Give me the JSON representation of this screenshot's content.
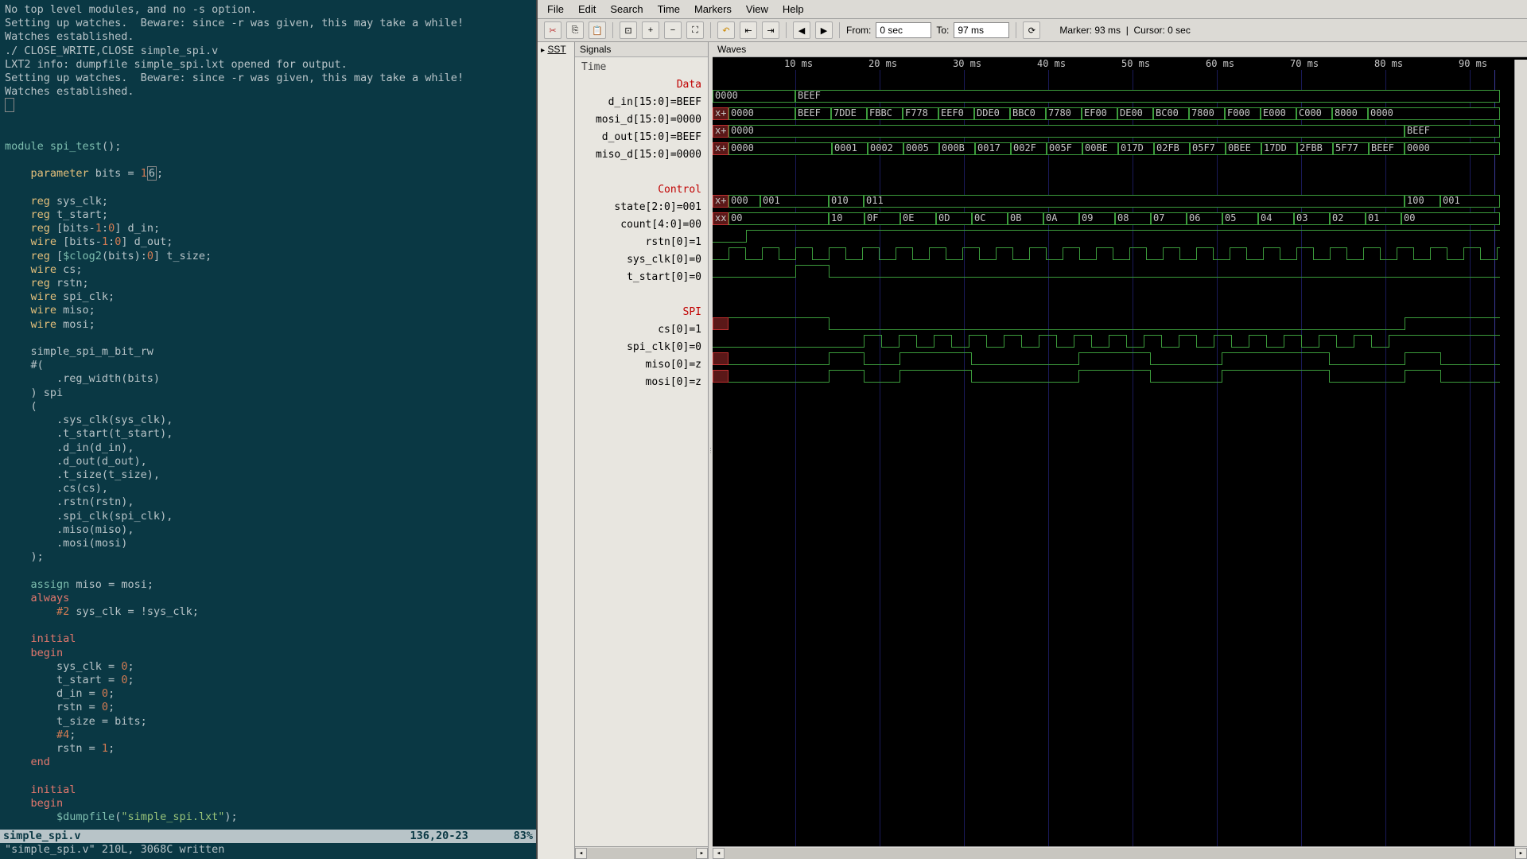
{
  "terminal": {
    "lines": [
      "No top level modules, and no -s option.",
      "Setting up watches.  Beware: since -r was given, this may take a while!",
      "Watches established.",
      "./ CLOSE_WRITE,CLOSE simple_spi.v",
      "LXT2 info: dumpfile simple_spi.lxt opened for output.",
      "Setting up watches.  Beware: since -r was given, this may take a while!",
      "Watches established."
    ]
  },
  "editor": {
    "status_file": "simple_spi.v",
    "status_pos": "136,20-23",
    "status_pct": "83%",
    "msg": "\"simple_spi.v\" 210L, 3068C written"
  },
  "gtkwave": {
    "menus": [
      "File",
      "Edit",
      "Search",
      "Time",
      "Markers",
      "View",
      "Help"
    ],
    "from_label": "From:",
    "from_value": "0 sec",
    "to_label": "To:",
    "to_value": "97 ms",
    "status_marker": "Marker: 93 ms",
    "status_cursor": "Cursor: 0 sec",
    "sst_label": "SST",
    "signals_label": "Signals",
    "waves_label": "Waves",
    "time_label": "Time",
    "timeticks": [
      "10 ms",
      "20 ms",
      "30 ms",
      "40 ms",
      "50 ms",
      "60 ms",
      "70 ms",
      "80 ms",
      "90 ms"
    ],
    "groups": {
      "data": "Data",
      "control": "Control",
      "spi": "SPI"
    },
    "signals": {
      "d_in": "d_in[15:0]=BEEF",
      "mosi_d": "mosi_d[15:0]=0000",
      "d_out": "d_out[15:0]=BEEF",
      "miso_d": "miso_d[15:0]=0000",
      "state": "state[2:0]=001",
      "count": "count[4:0]=00",
      "rstn": "rstn[0]=1",
      "sys_clk": "sys_clk[0]=0",
      "t_start": "t_start[0]=0",
      "cs": "cs[0]=1",
      "spi_clk": "spi_clk[0]=0",
      "miso": "miso[0]=z",
      "mosi": "mosi[0]=z"
    },
    "wave_values": {
      "d_in": [
        "0000",
        "BEEF"
      ],
      "mosi_d": [
        "x+",
        "0000",
        "BEEF",
        "7DDE",
        "FBBC",
        "F778",
        "EEF0",
        "DDE0",
        "BBC0",
        "7780",
        "EF00",
        "DE00",
        "BC00",
        "7800",
        "F000",
        "E000",
        "C000",
        "8000",
        "0000"
      ],
      "d_out": [
        "x+",
        "0000",
        "BEEF"
      ],
      "miso_d": [
        "x+",
        "0000",
        "0001",
        "0002",
        "0005",
        "000B",
        "0017",
        "002F",
        "005F",
        "00BE",
        "017D",
        "02FB",
        "05F7",
        "0BEE",
        "17DD",
        "2FBB",
        "5F77",
        "BEEF",
        "0000"
      ],
      "state": [
        "x+",
        "000",
        "001",
        "010",
        "011",
        "100",
        "001"
      ],
      "count": [
        "xx",
        "00",
        "10",
        "0F",
        "0E",
        "0D",
        "0C",
        "0B",
        "0A",
        "09",
        "08",
        "07",
        "06",
        "05",
        "04",
        "03",
        "02",
        "01",
        "00"
      ]
    }
  }
}
